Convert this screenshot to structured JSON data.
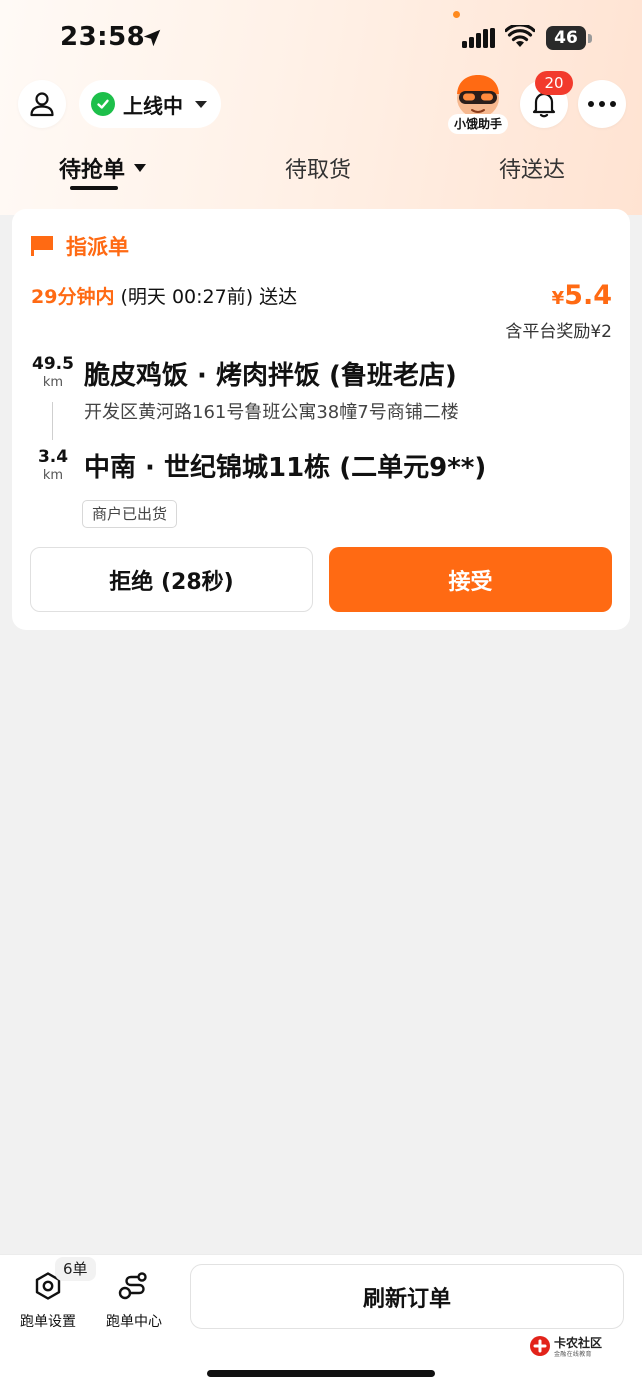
{
  "status_bar": {
    "time": "23:58",
    "battery": "46"
  },
  "header": {
    "online_status": "上线中",
    "assistant_label": "小饿助手",
    "notification_count": "20"
  },
  "tabs": [
    {
      "label": "待抢单",
      "active": true
    },
    {
      "label": "待取货",
      "active": false
    },
    {
      "label": "待送达",
      "active": false
    }
  ],
  "order": {
    "type": "指派单",
    "deadline_highlight": "29分钟内",
    "deadline_rest": "(明天 00:27前) 送达",
    "price_currency": "¥",
    "price_amount": "5.4",
    "bonus": "含平台奖励¥2",
    "pickup": {
      "distance": "49.5",
      "unit": "km",
      "name": "脆皮鸡饭 · 烤肉拌饭 (鲁班老店)",
      "address": "开发区黄河路161号鲁班公寓38幢7号商铺二楼"
    },
    "dropoff": {
      "distance": "3.4",
      "unit": "km",
      "name": "中南 · 世纪锦城11栋 (二单元9**)"
    },
    "tag": "商户已出货",
    "reject_label": "拒绝 (28秒)",
    "accept_label": "接受"
  },
  "bottom_bar": {
    "order_count": "6单",
    "run_settings_label": "跑单设置",
    "run_center_label": "跑单中心",
    "refresh_label": "刷新订单",
    "logo_text": "卡农社区",
    "logo_sub": "金融在线教育"
  },
  "colors": {
    "accent": "#ff6a13",
    "online_green": "#1dbf4a",
    "badge_red": "#f23a2c",
    "page_bg": "#f1f1f1"
  },
  "icons": [
    "location-arrow-icon",
    "signal-icon",
    "wifi-icon",
    "battery-icon",
    "profile-icon",
    "check-icon",
    "bell-icon",
    "more-icon",
    "flag-icon",
    "settings-icon",
    "run-center-icon"
  ]
}
